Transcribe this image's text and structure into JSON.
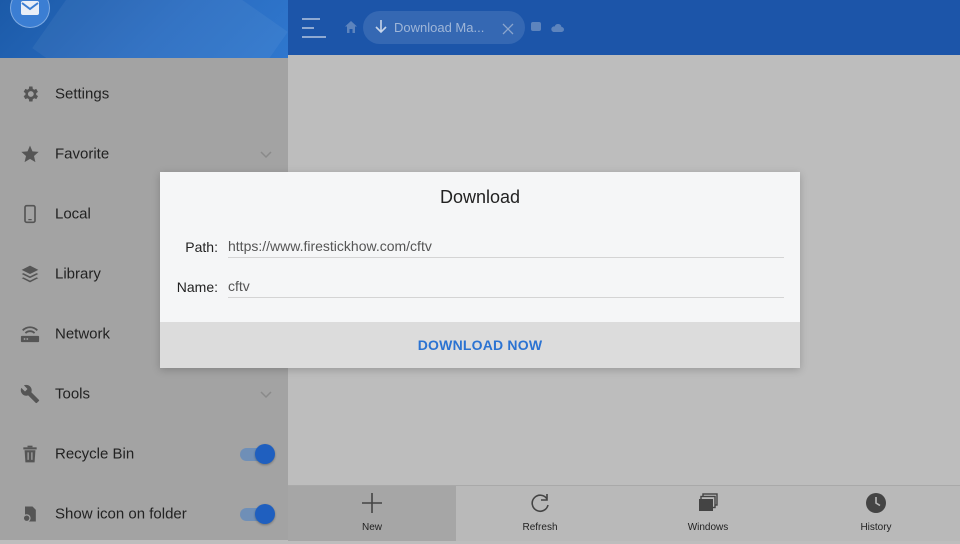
{
  "sidebar": {
    "items": [
      {
        "label": "Settings",
        "icon": "gear-icon"
      },
      {
        "label": "Favorite",
        "icon": "star-icon"
      },
      {
        "label": "Local",
        "icon": "phone-icon"
      },
      {
        "label": "Library",
        "icon": "layers-icon"
      },
      {
        "label": "Network",
        "icon": "router-icon"
      },
      {
        "label": "Tools",
        "icon": "wrench-icon"
      },
      {
        "label": "Recycle Bin",
        "icon": "trash-icon",
        "toggle_on": true
      },
      {
        "label": "Show icon on folder",
        "icon": "folder-file-icon",
        "toggle_on": true
      }
    ]
  },
  "topbar": {
    "tab_label": "Download Ma..."
  },
  "dialog": {
    "title": "Download",
    "path_label": "Path:",
    "path_value": "https://www.firestickhow.com/cftv",
    "name_label": "Name:",
    "name_value": "cftv",
    "action_label": "DOWNLOAD NOW"
  },
  "bottombar": {
    "items": [
      {
        "label": "New",
        "icon": "plus-icon"
      },
      {
        "label": "Refresh",
        "icon": "refresh-icon"
      },
      {
        "label": "Windows",
        "icon": "windows-icon"
      },
      {
        "label": "History",
        "icon": "clock-icon"
      }
    ]
  },
  "colors": {
    "topbar": "#1c55a9",
    "accent": "#2b73d2",
    "toggle": "#1f5fbf",
    "sidebar_bg": "#a3a3a3",
    "dim_bg": "#bdbdbd"
  }
}
